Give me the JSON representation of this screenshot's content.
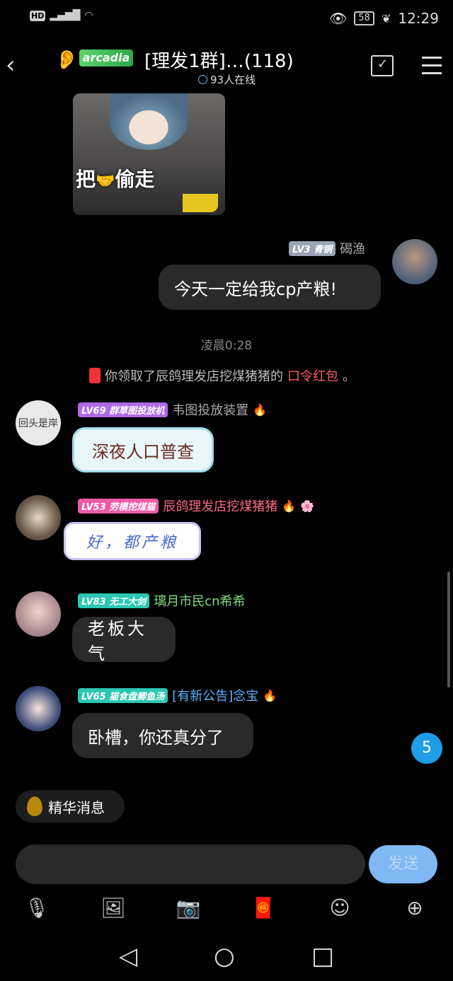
{
  "status_bar": {
    "hd": "HD",
    "signal": "4G",
    "battery": "58",
    "time": "12:29"
  },
  "header": {
    "logo_text": "arcadia",
    "title": "[理发1群]…(118)",
    "online": "93人在线"
  },
  "messages": {
    "m1": {
      "caption": "把",
      "caption2": "偷走"
    },
    "m2": {
      "level": "LV3",
      "title": "青铜",
      "nick": "碣渔",
      "text": "今天一定给我cp产粮!"
    },
    "timestamp": "凌晨0:28",
    "system": {
      "prefix": "你领取了辰鸽理发店挖煤猪猪的",
      "highlight": "口令红包",
      "suffix": "。"
    },
    "m3": {
      "level": "LV69",
      "title": "群草图投放机",
      "nick": "韦图投放装置",
      "text": "深夜人口普查",
      "avatar_text": "回头是岸"
    },
    "m4": {
      "level": "LV53",
      "title": "劳模挖煤猫",
      "nick": "辰鸽理发店挖煤猪猪",
      "text": "好，都产粮"
    },
    "m5": {
      "level": "LV83",
      "title": "无工大剑",
      "nick": "璃月市民cn希希",
      "text": "老板大气"
    },
    "m6": {
      "level": "LV65",
      "title": "猫食盘鲫鱼汤",
      "nick": "[有新公告]念宝",
      "text": "卧槽，你还真分了"
    }
  },
  "unread_count": "5",
  "essence_label": "精华消息",
  "input": {
    "send_label": "发送"
  },
  "colors": {
    "accent": "#1e9ee6",
    "send_btn": "#7fb8f5",
    "bubble": "#2a2a2a",
    "lv_purple": "#b06ae8",
    "lv_pink": "#ee5aa8",
    "lv_teal": "#2bc7b3",
    "lv_gray": "#9aa3b5"
  }
}
